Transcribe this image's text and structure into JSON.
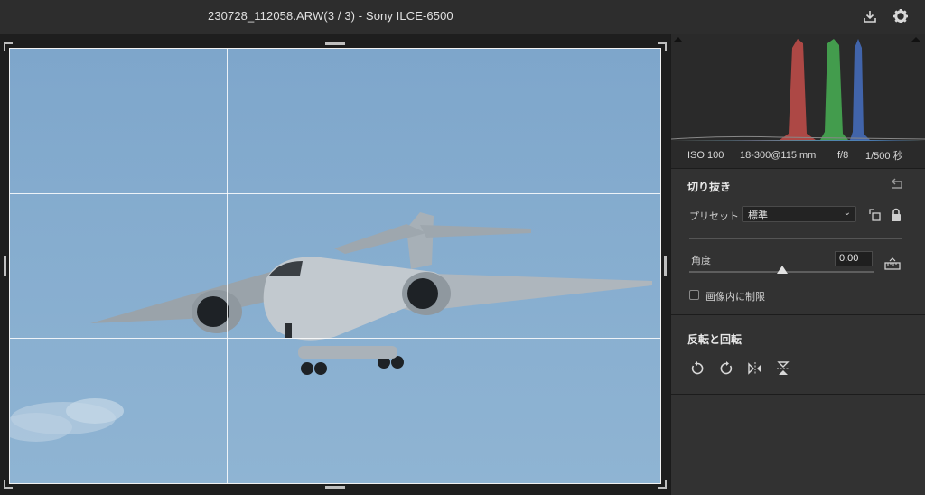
{
  "window": {
    "title": "230728_112058.ARW(3 / 3)  -  Sony ILCE-6500"
  },
  "toolbar": {
    "icons": [
      "download-icon",
      "gear-icon"
    ]
  },
  "exif": {
    "iso": "ISO 100",
    "lens": "18-300@115 mm",
    "aperture": "f/8",
    "shutter": "1/500 秒"
  },
  "crop": {
    "title": "切り抜き",
    "preset_label": "プリセット",
    "preset_value": "標準",
    "angle_label": "角度",
    "angle_value": "0.00",
    "angle_fraction": 0.5,
    "constrain_label": "画像内に制限"
  },
  "transform": {
    "title": "反転と回転"
  },
  "colors": {
    "hist_red": "#d9534f",
    "hist_green": "#4cc35a",
    "hist_blue": "#4a78d6",
    "sky": "#86adcf"
  }
}
